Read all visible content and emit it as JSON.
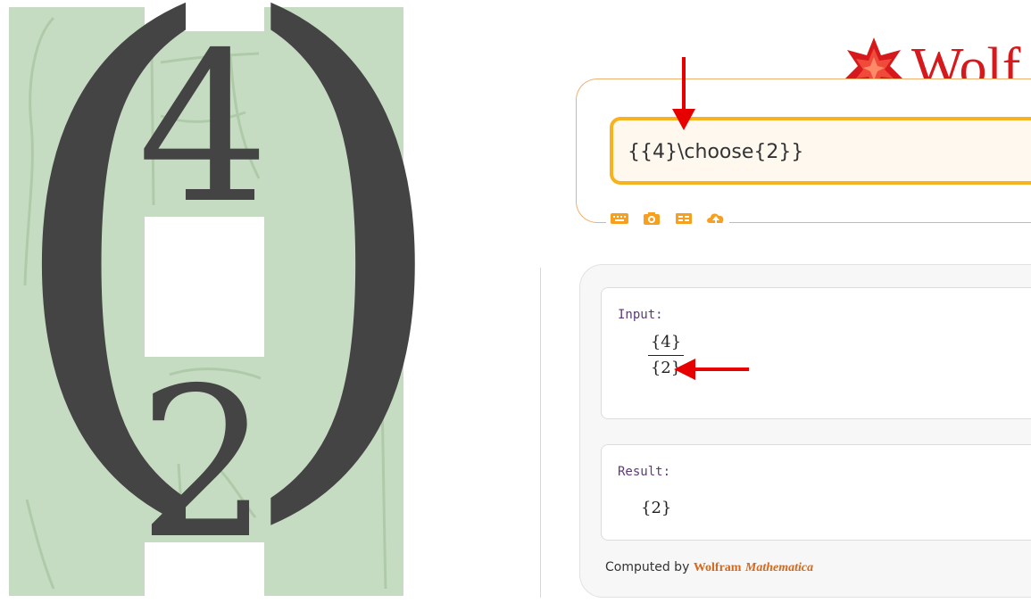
{
  "left_render": {
    "paren_left": "(",
    "paren_right": ")",
    "top_digit": "4",
    "bottom_digit": "2"
  },
  "wolfram": {
    "logo_text": "Wolf",
    "query_value": "{{4}\\choose{2}}",
    "toolbar_icons": [
      "keyboard-icon",
      "camera-icon",
      "examples-icon",
      "upload-icon"
    ],
    "input_pod": {
      "title": "Input:",
      "numerator": "{4}",
      "denominator": "{2}"
    },
    "result_pod": {
      "title": "Result:",
      "value": "{2}"
    },
    "footer": {
      "prefix": "Computed by ",
      "brand": "Wolfram",
      "product": "Mathematica"
    }
  },
  "colors": {
    "green_highlight": "#c6dcc2",
    "glyph_gray": "#444444",
    "arrow_red": "#e60000",
    "query_border": "#f7b21f",
    "pod_title": "#5b3a78",
    "brand_orange": "#d2691e"
  }
}
